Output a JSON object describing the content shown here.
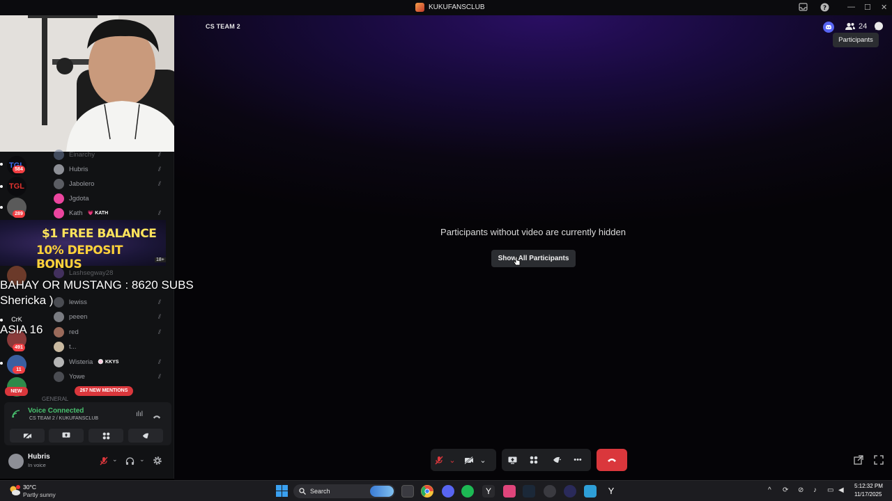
{
  "window": {
    "title": "KUKUFANSCLUB",
    "min": "—",
    "max": "☐",
    "close": "✕"
  },
  "stage": {
    "channel": "CS TEAM 2",
    "message": "Participants without video are currently hidden",
    "show_all_label": "Show All Participants",
    "participant_count": "24",
    "tooltip": "Participants"
  },
  "sidebar": {
    "servers": [
      {
        "badge": "584"
      },
      {
        "badge": ""
      },
      {
        "badge": "289"
      },
      {
        "badge": ""
      },
      {
        "badge": "491"
      },
      {
        "badge": "11"
      }
    ],
    "server_label_crk": "CrK",
    "new_badge": "NEW",
    "members": [
      {
        "name": "Einarchy"
      },
      {
        "name": "Hubris"
      },
      {
        "name": "Jabolero"
      },
      {
        "name": "Jgdota"
      },
      {
        "name": "Kath",
        "tag": "KATH"
      },
      {
        "name": "Lashsegway28"
      },
      {
        "name": "lewiss"
      },
      {
        "name": "peeen"
      },
      {
        "name": "red"
      },
      {
        "name": "t..."
      },
      {
        "name": "Wisteria",
        "tag": "KKYS"
      },
      {
        "name": "Yowe"
      }
    ],
    "mentions": "267 NEW MENTIONS",
    "general_category": "GENERAL",
    "ad": {
      "line1": "$1 FREE BALANCE",
      "line2": "10% DEPOSIT BONUS",
      "age": "18+"
    },
    "overlay": {
      "line1": "BAHAY OR MUSTANG : 8620 SUBS",
      "line2": "Shericka )",
      "line3": "ASIA 16"
    }
  },
  "voice": {
    "title": "Voice Connected",
    "subtitle": "CS TEAM 2 / KUKUFANSCLUB"
  },
  "user": {
    "name": "Hubris",
    "status": "In voice"
  },
  "taskbar": {
    "weather_temp": "30°C",
    "weather_desc": "Partly sunny",
    "search_placeholder": "Search",
    "time": "5:12:32 PM",
    "date": "11/17/2025"
  },
  "colors": {
    "accent": "#5865f2",
    "danger": "#da373c",
    "voice_green": "#48c06e"
  }
}
